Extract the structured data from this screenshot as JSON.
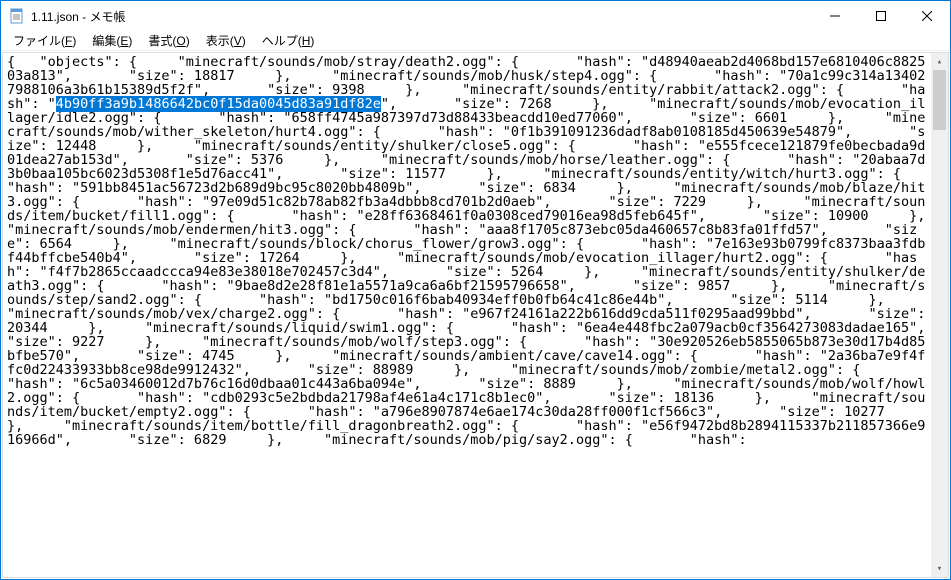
{
  "window": {
    "title": "1.11.json - メモ帳",
    "icon": "notepad-icon"
  },
  "menu": {
    "file": "ファイル(F)",
    "edit": "編集(E)",
    "format": "書式(O)",
    "view": "表示(V)",
    "help": "ヘルプ(H)"
  },
  "selection": "4b90ff3a9b1486642bc0f15da0045d83a91df82e",
  "text_before": "{   \"objects\": {     \"minecraft/sounds/mob/stray/death2.ogg\": {       \"hash\": \"d48940aeab2d4068bd157e6810406c882503a813\",       \"size\": 18817     },     \"minecraft/sounds/mob/husk/step4.ogg\": {       \"hash\": \"70a1c99c314a134027988106a3b61b15389d5f2f\",       \"size\": 9398     },     \"minecraft/sounds/entity/rabbit/attack2.ogg\": {       \"hash\": \"",
  "text_after": "\",       \"size\": 7268     },     \"minecraft/sounds/mob/evocation_illager/idle2.ogg\": {       \"hash\": \"658ff4745a987397d73d88433beacdd10ed77060\",       \"size\": 6601     },     \"minecraft/sounds/mob/wither_skeleton/hurt4.ogg\": {       \"hash\": \"0f1b391091236dadf8ab0108185d450639e54879\",       \"size\": 12448     },     \"minecraft/sounds/entity/shulker/close5.ogg\": {       \"hash\": \"e555fcece121879fe0becbada9d01dea27ab153d\",       \"size\": 5376     },     \"minecraft/sounds/mob/horse/leather.ogg\": {       \"hash\": \"20abaa7d3b0baa105bc6023d5308f1e5d76acc41\",       \"size\": 11577     },     \"minecraft/sounds/entity/witch/hurt3.ogg\": {       \"hash\": \"591bb8451ac56723d2b689d9bc95c8020bb4809b\",       \"size\": 6834     },     \"minecraft/sounds/mob/blaze/hit3.ogg\": {       \"hash\": \"97e09d51c82b78ab82fb3a4dbbb8cd701b2d0aeb\",       \"size\": 7229     },     \"minecraft/sounds/item/bucket/fill1.ogg\": {       \"hash\": \"e28ff6368461f0a0308ced79016ea98d5feb645f\",       \"size\": 10900     },     \"minecraft/sounds/mob/endermen/hit3.ogg\": {       \"hash\": \"aaa8f1705c873ebc05da460657c8b83fa01ffd57\",       \"size\": 6564     },     \"minecraft/sounds/block/chorus_flower/grow3.ogg\": {       \"hash\": \"7e163e93b0799fc8373baa3fdbf44bffcbe540b4\",       \"size\": 17264     },     \"minecraft/sounds/mob/evocation_illager/hurt2.ogg\": {       \"hash\": \"f4f7b2865ccaadccca94e83e38018e702457c3d4\",       \"size\": 5264     },     \"minecraft/sounds/entity/shulker/death3.ogg\": {       \"hash\": \"9bae8d2e28f81e1a5571a9ca6a6bf21595796658\",       \"size\": 9857     },     \"minecraft/sounds/step/sand2.ogg\": {       \"hash\": \"bd1750c016f6bab40934eff0b0fb64c41c86e44b\",       \"size\": 5114     },     \"minecraft/sounds/mob/vex/charge2.ogg\": {       \"hash\": \"e967f24161a222b616dd9cda511f0295aad99bbd\",       \"size\": 20344     },     \"minecraft/sounds/liquid/swim1.ogg\": {       \"hash\": \"6ea4e448fbc2a079acb0cf3564273083dadae165\",       \"size\": 9227     },     \"minecraft/sounds/mob/wolf/step3.ogg\": {       \"hash\": \"30e920526eb5855065b873e30d17b4d85bfbe570\",       \"size\": 4745     },     \"minecraft/sounds/ambient/cave/cave14.ogg\": {       \"hash\": \"2a36ba7e9f4ffc0d22433933bb8ce98de9912432\",       \"size\": 88989     },     \"minecraft/sounds/mob/zombie/metal2.ogg\": {       \"hash\": \"6c5a03460012d7b76c16d0dbaa01c443a6ba094e\",       \"size\": 8889     },     \"minecraft/sounds/mob/wolf/howl2.ogg\": {       \"hash\": \"cdb0293c5e2bdbda21798af4e61a4c171c8b1ec0\",       \"size\": 18136     },     \"minecraft/sounds/item/bucket/empty2.ogg\": {       \"hash\": \"a796e8907874e6ae174c30da28ff000f1cf566c3\",       \"size\": 10277     },     \"minecraft/sounds/item/bottle/fill_dragonbreath2.ogg\": {       \"hash\": \"e56f9472bd8b2894115337b211857366e916966d\",       \"size\": 6829     },     \"minecraft/sounds/mob/pig/say2.ogg\": {       \"hash\": "
}
